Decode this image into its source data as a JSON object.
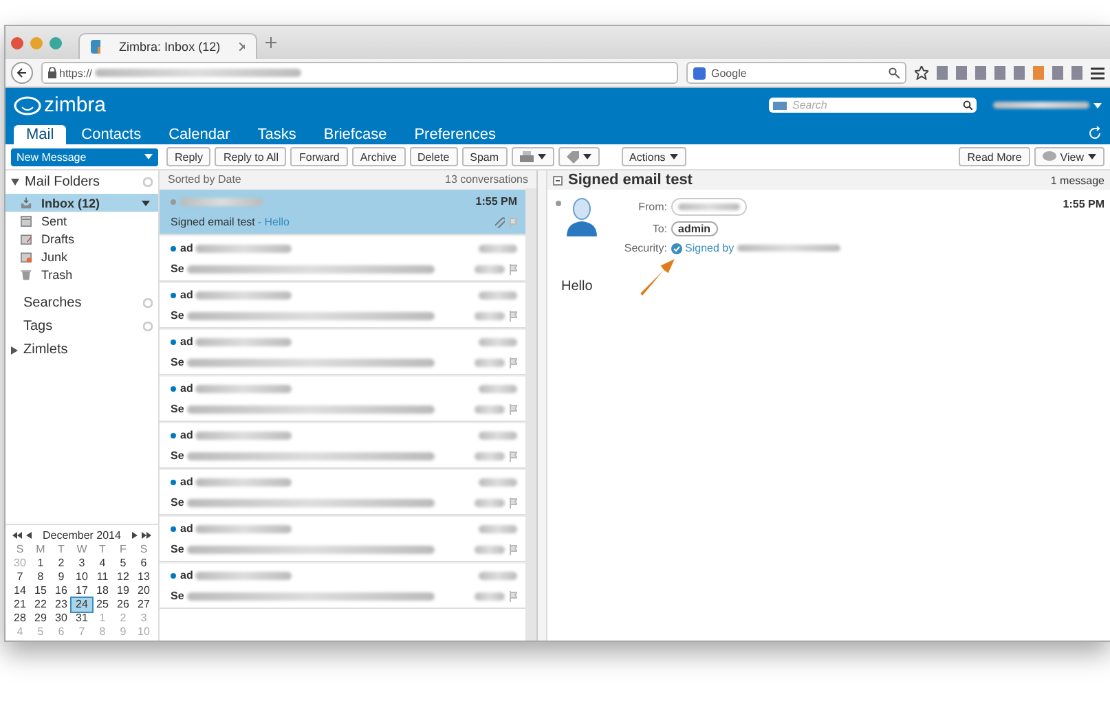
{
  "browser": {
    "tabs": [
      {
        "title": "Zimbra: Inbox (12)",
        "selected": true
      }
    ],
    "url": "https://",
    "search_engine": "Google"
  },
  "app": {
    "logo": "zimbra",
    "search_placeholder": "Search",
    "nav_tabs": [
      {
        "label": "Mail",
        "selected": true
      },
      {
        "label": "Contacts",
        "selected": false
      },
      {
        "label": "Calendar",
        "selected": false
      },
      {
        "label": "Tasks",
        "selected": false
      },
      {
        "label": "Briefcase",
        "selected": false
      },
      {
        "label": "Preferences",
        "selected": false
      }
    ]
  },
  "toolbar": {
    "new_message": "New Message",
    "buttons": [
      "Reply",
      "Reply to All",
      "Forward",
      "Archive",
      "Delete",
      "Spam"
    ],
    "actions": "Actions",
    "read_more": "Read More",
    "view": "View"
  },
  "folders": {
    "title": "Mail Folders",
    "expanded": true,
    "items": [
      {
        "label": "Inbox (12)",
        "selected": true
      },
      {
        "label": "Sent",
        "selected": false
      },
      {
        "label": "Drafts",
        "selected": false
      },
      {
        "label": "Junk",
        "selected": false
      },
      {
        "label": "Trash",
        "selected": false
      }
    ]
  },
  "sections": [
    {
      "label": "Searches",
      "kind": "gear"
    },
    {
      "label": "Tags",
      "kind": "gear"
    },
    {
      "label": "Zimlets",
      "kind": "collapsed"
    }
  ],
  "calendar": {
    "title": "December 2014",
    "weekdays": [
      "S",
      "M",
      "T",
      "W",
      "T",
      "F",
      "S"
    ],
    "weeks": [
      [
        {
          "d": "30",
          "muted": true,
          "selected": false
        },
        {
          "d": "1",
          "muted": false,
          "selected": false
        },
        {
          "d": "2",
          "muted": false,
          "selected": false
        },
        {
          "d": "3",
          "muted": false,
          "selected": false
        },
        {
          "d": "4",
          "muted": false,
          "selected": false
        },
        {
          "d": "5",
          "muted": false,
          "selected": false
        },
        {
          "d": "6",
          "muted": false,
          "selected": false
        }
      ],
      [
        {
          "d": "7",
          "muted": false,
          "selected": false
        },
        {
          "d": "8",
          "muted": false,
          "selected": false
        },
        {
          "d": "9",
          "muted": false,
          "selected": false
        },
        {
          "d": "10",
          "muted": false,
          "selected": false
        },
        {
          "d": "11",
          "muted": false,
          "selected": false
        },
        {
          "d": "12",
          "muted": false,
          "selected": false
        },
        {
          "d": "13",
          "muted": false,
          "selected": false
        }
      ],
      [
        {
          "d": "14",
          "muted": false,
          "selected": false
        },
        {
          "d": "15",
          "muted": false,
          "selected": false
        },
        {
          "d": "16",
          "muted": false,
          "selected": false
        },
        {
          "d": "17",
          "muted": false,
          "selected": false
        },
        {
          "d": "18",
          "muted": false,
          "selected": false
        },
        {
          "d": "19",
          "muted": false,
          "selected": false
        },
        {
          "d": "20",
          "muted": false,
          "selected": false
        }
      ],
      [
        {
          "d": "21",
          "muted": false,
          "selected": false
        },
        {
          "d": "22",
          "muted": false,
          "selected": false
        },
        {
          "d": "23",
          "muted": false,
          "selected": false
        },
        {
          "d": "24",
          "muted": false,
          "selected": true
        },
        {
          "d": "25",
          "muted": false,
          "selected": false
        },
        {
          "d": "26",
          "muted": false,
          "selected": false
        },
        {
          "d": "27",
          "muted": false,
          "selected": false
        }
      ],
      [
        {
          "d": "28",
          "muted": false,
          "selected": false
        },
        {
          "d": "29",
          "muted": false,
          "selected": false
        },
        {
          "d": "30",
          "muted": false,
          "selected": false
        },
        {
          "d": "31",
          "muted": false,
          "selected": false
        },
        {
          "d": "1",
          "muted": true,
          "selected": false
        },
        {
          "d": "2",
          "muted": true,
          "selected": false
        },
        {
          "d": "3",
          "muted": true,
          "selected": false
        }
      ],
      [
        {
          "d": "4",
          "muted": true,
          "selected": false
        },
        {
          "d": "5",
          "muted": true,
          "selected": false
        },
        {
          "d": "6",
          "muted": true,
          "selected": false
        },
        {
          "d": "7",
          "muted": true,
          "selected": false
        },
        {
          "d": "8",
          "muted": true,
          "selected": false
        },
        {
          "d": "9",
          "muted": true,
          "selected": false
        },
        {
          "d": "10",
          "muted": true,
          "selected": false
        }
      ]
    ]
  },
  "message_list": {
    "sort": "Sorted by Date",
    "count": "13 conversations",
    "messages": [
      {
        "subject": "Signed email test",
        "fragment": "- Hello",
        "time": "1:55 PM",
        "unread": false,
        "selected": true
      },
      {
        "sender": "ad",
        "subject": "Se",
        "unread": true,
        "selected": false
      },
      {
        "sender": "ad",
        "subject": "Se",
        "unread": true,
        "selected": false
      },
      {
        "sender": "ad",
        "subject": "Se",
        "unread": true,
        "selected": false
      },
      {
        "sender": "ad",
        "subject": "Se",
        "unread": true,
        "selected": false
      },
      {
        "sender": "ad",
        "subject": "Se",
        "unread": true,
        "selected": false
      },
      {
        "sender": "ad",
        "subject": "Se",
        "unread": true,
        "selected": false
      },
      {
        "sender": "ad",
        "subject": "Se",
        "unread": true,
        "selected": false
      },
      {
        "sender": "ad",
        "subject": "Se",
        "unread": true,
        "selected": false
      }
    ]
  },
  "reading_pane": {
    "subject": "Signed email test",
    "count": "1 message",
    "from_label": "From:",
    "to_label": "To:",
    "to": "admin",
    "security_label": "Security:",
    "signed": "Signed by",
    "time": "1:55 PM",
    "body": "Hello"
  }
}
